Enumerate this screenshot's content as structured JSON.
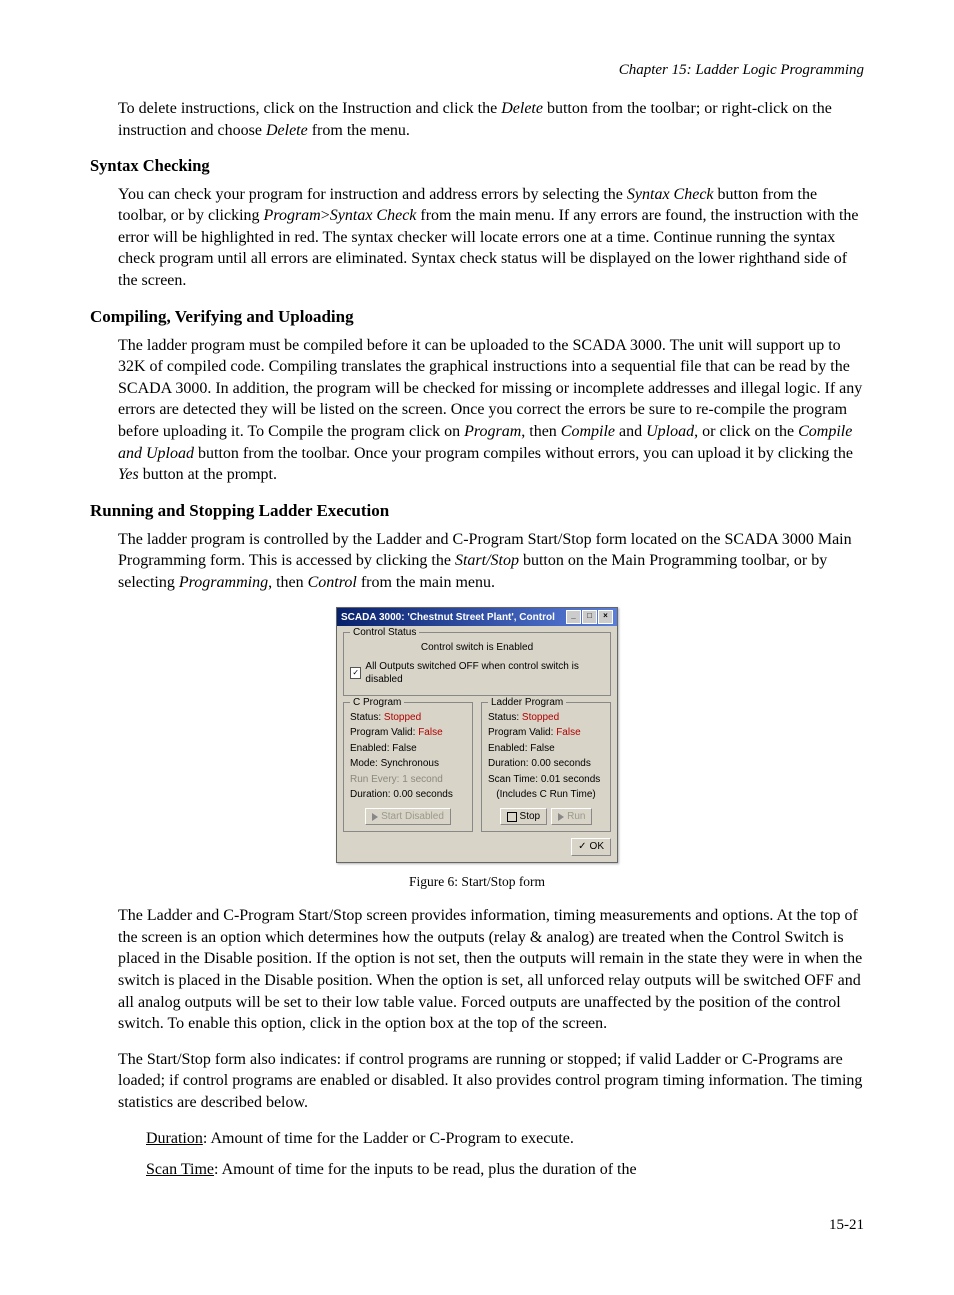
{
  "chapterHeader": "Chapter 15: Ladder Logic Programming",
  "intro": {
    "p1a": "To delete instructions, click on the Instruction and click the ",
    "p1b": "Delete",
    "p1c": " button from the toolbar; or right-click on the instruction and choose ",
    "p1d": "Delete",
    "p1e": " from the menu."
  },
  "syntax": {
    "heading": "Syntax Checking",
    "p1a": "You can check your program for instruction and address errors by selecting the ",
    "p1b": "Syntax Check",
    "p1c": " button from the toolbar, or by clicking ",
    "p1d": "Program",
    "p1e": ">",
    "p1f": "Syntax Check",
    "p1g": " from the main menu. If any errors are found, the instruction with the error will be highlighted in red. The syntax checker will locate errors one at a time. Continue running the syntax check program until all errors are eliminated. Syntax check status will be displayed on the lower righthand side of the screen."
  },
  "compile": {
    "heading": "Compiling, Verifying and Uploading",
    "p1a": "The ladder program must be compiled before it can be uploaded to the SCADA 3000. The unit will support up to 32K of compiled code. Compiling translates the graphical instructions into a sequential file that can be read by the SCADA 3000. In addition, the program will be checked for missing or incomplete addresses and illegal logic. If any errors are detected they will be listed on the screen. Once you correct the errors be sure to re-compile the program before uploading it. To Compile the program click on ",
    "p1b": "Program",
    "p1c": ", then ",
    "p1d": "Compile",
    "p1e": " and ",
    "p1f": "Upload",
    "p1g": ", or click on the ",
    "p1h": "Compile and Upload",
    "p1i": " button from the toolbar. Once your program compiles without errors, you can upload it by clicking the ",
    "p1j": "Yes",
    "p1k": " button at the prompt."
  },
  "running": {
    "heading": "Running and Stopping Ladder Execution",
    "p1a": "The ladder program is controlled by the Ladder and C-Program Start/Stop form located on the SCADA 3000 Main Programming form.  This is accessed by clicking the ",
    "p1b": "Start/Stop",
    "p1c": " button on the Main Programming toolbar, or by selecting ",
    "p1d": "Programming",
    "p1e": ", then ",
    "p1f": "Control",
    "p1g": " from the main menu."
  },
  "dialog": {
    "title": "SCADA 3000: 'Chestnut Street Plant', Control",
    "controlStatusLabel": "Control Status",
    "controlSwitch": "Control switch is Enabled",
    "outputsOff": "All Outputs switched OFF when control switch is disabled",
    "cprog": {
      "title": "C Program",
      "statusLabel": "Status:",
      "statusValue": "Stopped",
      "validLabel": "Program Valid:",
      "validValue": "False",
      "enabledLabel": "Enabled:",
      "enabledValue": "False",
      "modeLabel": "Mode:",
      "modeValue": "Synchronous",
      "runEveryLabel": "Run Every:",
      "runEveryValue": "1 second",
      "durationLabel": "Duration:",
      "durationValue": "0.00 seconds",
      "startDisabledBtn": "Start Disabled"
    },
    "ladder": {
      "title": "Ladder Program",
      "statusLabel": "Status:",
      "statusValue": "Stopped",
      "validLabel": "Program Valid:",
      "validValue": "False",
      "enabledLabel": "Enabled:",
      "enabledValue": "False",
      "durationLabel": "Duration:",
      "durationValue": "0.00 seconds",
      "scanLabel": "Scan Time:",
      "scanValue": "0.01 seconds",
      "note": "(Includes C Run Time)",
      "stopBtn": "Stop",
      "runBtn": "Run"
    },
    "okBtn": "OK"
  },
  "figureCaption": "Figure 6: Start/Stop form",
  "after": {
    "p1": "The Ladder and C-Program Start/Stop screen provides information, timing measurements and options. At the top of the screen is an option which determines how the outputs (relay & analog) are treated when the Control Switch is placed in the Disable position. If the option is not set, then the outputs will remain in the state they were in when the switch is placed in the Disable position. When the option is set, all unforced relay outputs will be switched OFF and all analog outputs will be set to their low table value. Forced outputs are unaffected by the position of the control switch. To enable this option, click in the option box at the top of the screen.",
    "p2": "The Start/Stop form also indicates: if control programs are running or stopped; if valid Ladder or C-Programs are loaded; if control programs are enabled or disabled. It also provides control program timing information. The timing statistics are described below."
  },
  "terms": {
    "durationLabel": "Duration",
    "durationText": ": Amount of time for the Ladder or C-Program to execute.",
    "scanLabel": "Scan Time",
    "scanText": ": Amount of time for the inputs to be read, plus the duration of the"
  },
  "pageNum": "15-21"
}
